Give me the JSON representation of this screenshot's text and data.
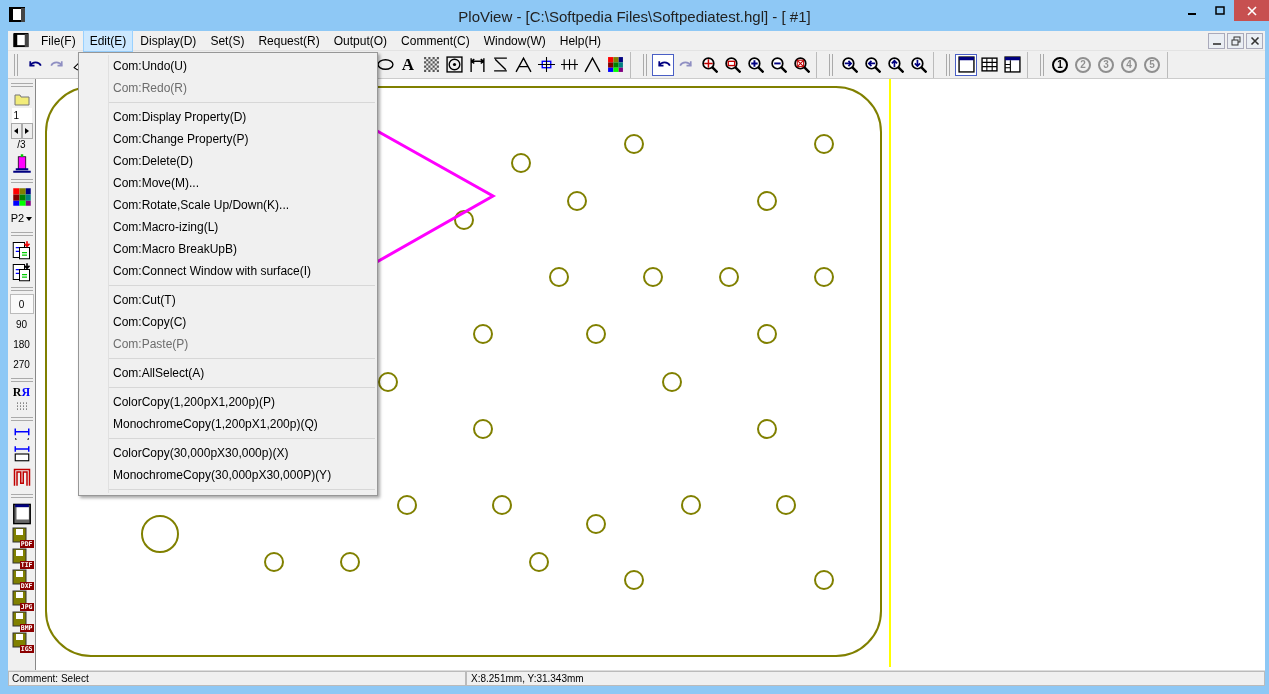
{
  "window": {
    "title": "PloView - [C:\\Softpedia Files\\Softpediatest.hgl] - [ #1]"
  },
  "menu_bar": [
    {
      "label": "File(F)",
      "selected": false
    },
    {
      "label": "Edit(E)",
      "selected": true
    },
    {
      "label": "Display(D)",
      "selected": false
    },
    {
      "label": "Set(S)",
      "selected": false
    },
    {
      "label": "Request(R)",
      "selected": false
    },
    {
      "label": "Output(O)",
      "selected": false
    },
    {
      "label": "Comment(C)",
      "selected": false
    },
    {
      "label": "Window(W)",
      "selected": false
    },
    {
      "label": "Help(H)",
      "selected": false
    }
  ],
  "toolbar": [
    {
      "buttons": [
        {
          "kind": "undo-arrow",
          "disabled": false,
          "pressed": false
        },
        {
          "kind": "redo-arrow",
          "disabled": true,
          "pressed": false
        },
        {
          "kind": "eraser",
          "disabled": false,
          "pressed": false
        }
      ]
    },
    {
      "buttons": [
        {
          "kind": "ellipse",
          "disabled": false
        },
        {
          "kind": "letter",
          "label": "A",
          "disabled": false
        },
        {
          "kind": "checker",
          "disabled": false
        },
        {
          "kind": "target",
          "disabled": false
        },
        {
          "kind": "dimension",
          "disabled": false
        },
        {
          "kind": "slope",
          "disabled": false
        },
        {
          "kind": "arch",
          "disabled": false
        },
        {
          "kind": "crosshair",
          "disabled": false
        },
        {
          "kind": "ticks-line",
          "disabled": false
        },
        {
          "kind": "peak",
          "disabled": false
        },
        {
          "kind": "color-grid",
          "disabled": false
        }
      ]
    },
    {
      "buttons": [
        {
          "kind": "undo-arrow",
          "disabled": false,
          "pressed": true
        },
        {
          "kind": "redo-arrow",
          "disabled": true,
          "pressed": false
        },
        {
          "kind": "magnifier-cross",
          "disabled": false,
          "pressed": false
        },
        {
          "kind": "magnifier-rect",
          "disabled": false,
          "pressed": false
        },
        {
          "kind": "magnifier-plus",
          "disabled": false,
          "pressed": false
        },
        {
          "kind": "magnifier-minus",
          "disabled": false,
          "pressed": false
        },
        {
          "kind": "magnifier-x",
          "disabled": false,
          "pressed": false
        }
      ]
    },
    {
      "buttons": [
        {
          "kind": "magnifier-right",
          "disabled": false,
          "pressed": false
        },
        {
          "kind": "magnifier-left",
          "disabled": false,
          "pressed": false
        },
        {
          "kind": "magnifier-up",
          "disabled": false,
          "pressed": false
        },
        {
          "kind": "magnifier-down",
          "disabled": false,
          "pressed": false
        }
      ]
    },
    {
      "buttons": [
        {
          "kind": "window",
          "disabled": false,
          "pressed": true
        },
        {
          "kind": "grid",
          "disabled": false,
          "pressed": false
        },
        {
          "kind": "panes",
          "disabled": false,
          "pressed": false
        }
      ]
    },
    {
      "buttons": [
        {
          "kind": "zoom-preset",
          "label": "1",
          "disabled": false,
          "pressed": false
        },
        {
          "kind": "zoom-preset",
          "label": "2",
          "disabled": true,
          "pressed": false
        },
        {
          "kind": "zoom-preset",
          "label": "3",
          "disabled": true,
          "pressed": false
        },
        {
          "kind": "zoom-preset",
          "label": "4",
          "disabled": true,
          "pressed": false
        },
        {
          "kind": "zoom-preset",
          "label": "5",
          "disabled": true,
          "pressed": false
        }
      ]
    }
  ],
  "left_toolbar": {
    "page": "1",
    "page_count": "/3",
    "palette": "P2",
    "rotations": [
      {
        "label": "0",
        "selected": true
      },
      {
        "label": "90",
        "selected": false
      },
      {
        "label": "180",
        "selected": false
      },
      {
        "label": "270",
        "selected": false
      }
    ],
    "mirror": [
      "R",
      "Я"
    ],
    "save_formats": [
      "PDF",
      "TIF",
      "DXF",
      "JPG",
      "BMP",
      "IGS"
    ]
  },
  "edit_menu": [
    {
      "kind": "item",
      "label": "Com:Undo(U)",
      "disabled": false
    },
    {
      "kind": "item",
      "label": "Com:Redo(R)",
      "disabled": true
    },
    {
      "kind": "separator"
    },
    {
      "kind": "item",
      "label": "Com:Display Property(D)",
      "disabled": false
    },
    {
      "kind": "item",
      "label": "Com:Change Property(P)",
      "disabled": false
    },
    {
      "kind": "item",
      "label": "Com:Delete(D)",
      "disabled": false
    },
    {
      "kind": "item",
      "label": "Com:Move(M)...",
      "disabled": false
    },
    {
      "kind": "item",
      "label": "Com:Rotate,Scale Up/Down(K)...",
      "disabled": false
    },
    {
      "kind": "item",
      "label": "Com:Macro-izing(L)",
      "disabled": false
    },
    {
      "kind": "item",
      "label": "Com:Macro BreakUpB)",
      "disabled": false
    },
    {
      "kind": "item",
      "label": "Com:Connect Window with surface(I)",
      "disabled": false
    },
    {
      "kind": "separator"
    },
    {
      "kind": "item",
      "label": "Com:Cut(T)",
      "disabled": false
    },
    {
      "kind": "item",
      "label": "Com:Copy(C)",
      "disabled": false
    },
    {
      "kind": "item",
      "label": "Com:Paste(P)",
      "disabled": true
    },
    {
      "kind": "separator"
    },
    {
      "kind": "item",
      "label": "Com:AllSelect(A)",
      "disabled": false
    },
    {
      "kind": "separator"
    },
    {
      "kind": "item",
      "label": "ColorCopy(1,200pX1,200p)(P)",
      "disabled": false
    },
    {
      "kind": "item",
      "label": "MonochromeCopy(1,200pX1,200p)(Q)",
      "disabled": false
    },
    {
      "kind": "separator"
    },
    {
      "kind": "item",
      "label": "ColorCopy(30,000pX30,000p)(X)",
      "disabled": false
    },
    {
      "kind": "item",
      "label": "MonochromeCopy(30,000pX30,000P)(Y)",
      "disabled": false
    },
    {
      "kind": "separator"
    }
  ],
  "status_bar": [
    "Comment: Select",
    "X:8.251mm, Y:31.343mm"
  ]
}
